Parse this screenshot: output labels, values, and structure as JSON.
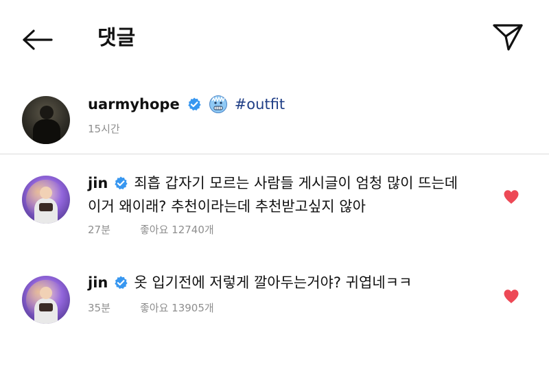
{
  "header": {
    "title": "댓글"
  },
  "post": {
    "username": "uarmyhope",
    "hashtag": "#outfit",
    "time": "15시간"
  },
  "comments": [
    {
      "username": "jin",
      "line1": "죄흡 갑자기 모르는 사람들 게시글이 엄청 많이 뜨는데",
      "line2": "이거 왜이래? 추천이라는데 추천받고싶지 않아",
      "time": "27분",
      "likes": "좋아요 12740개"
    },
    {
      "username": "jin",
      "line1": "옷 입기전에 저렇게 깔아두는거야? 귀엽네ㅋㅋ",
      "line2": "",
      "time": "35분",
      "likes": "좋아요 13905개"
    }
  ],
  "colors": {
    "heart": "#ed4956",
    "verified": "#3897f0",
    "hashtag": "#1f3e86",
    "muted": "#8e8e8e"
  },
  "icons": {
    "back": "arrow-left-icon",
    "share": "paper-plane-icon",
    "verified": "verified-badge-icon",
    "emoji": "cold-face-emoji",
    "like": "heart-icon"
  }
}
